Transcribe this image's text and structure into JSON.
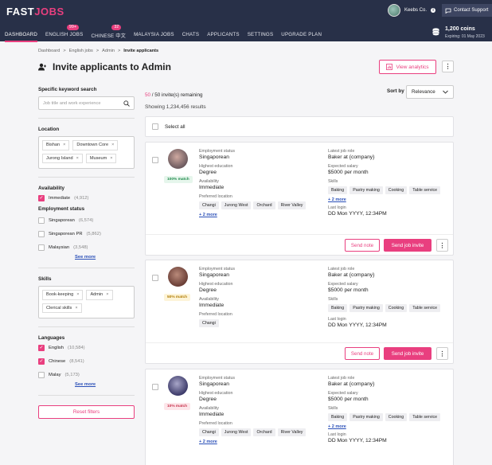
{
  "brand": {
    "logo_left": "FAST",
    "logo_right": "JOBS"
  },
  "colors": {
    "accent": "#e93f7f",
    "nav_bg": "#283048",
    "link": "#2b50b8"
  },
  "topbar": {
    "company": "Keebs Co.",
    "support": "Contact Support",
    "coins": "1,200 coins",
    "expiring": "Expiring: 01 May 2023"
  },
  "nav": [
    {
      "label": "DASHBOARD",
      "active": true,
      "badge": ""
    },
    {
      "label": "ENGLISH JOBS",
      "active": false,
      "badge": "99+"
    },
    {
      "label": "CHINESE 中文",
      "active": false,
      "badge": "32"
    },
    {
      "label": "MALAYSIA JOBS",
      "active": false,
      "badge": ""
    },
    {
      "label": "CHATS",
      "active": false,
      "badge": ""
    },
    {
      "label": "APPLICANTS",
      "active": false,
      "badge": ""
    },
    {
      "label": "SETTINGS",
      "active": false,
      "badge": ""
    },
    {
      "label": "UPGRADE PLAN",
      "active": false,
      "badge": ""
    }
  ],
  "breadcrumb": [
    "Dashboard",
    "English jobs",
    "Admin",
    "Invite applicants"
  ],
  "breadcrumb_sep": ">",
  "page_title": "Invite applicants to Admin",
  "view_analytics": "View analytics",
  "filters": {
    "keyword_label": "Specific keyword search",
    "keyword_placeholder": "Job title and work experience",
    "location_label": "Location",
    "locations": [
      "Bishan",
      "Downtown Core",
      "Jurong Island",
      "Museum"
    ],
    "availability_label": "Availability",
    "availability": [
      {
        "label": "Immediate",
        "count": "(4,912)",
        "checked": true
      }
    ],
    "employment_label": "Employment status",
    "employment": [
      {
        "label": "Singaporean",
        "count": "(6,574)",
        "checked": false
      },
      {
        "label": "Singaporean PR",
        "count": "(5,862)",
        "checked": false
      },
      {
        "label": "Malaysian",
        "count": "(3,548)",
        "checked": false
      }
    ],
    "see_more": "See more",
    "skills_label": "Skills",
    "skills": [
      "Book-keeping",
      "Admin",
      "Clerical skills"
    ],
    "languages_label": "Languages",
    "languages": [
      {
        "label": "English",
        "count": "(10,584)",
        "checked": true
      },
      {
        "label": "Chinese",
        "count": "(8,541)",
        "checked": true
      },
      {
        "label": "Malay",
        "count": "(5,173)",
        "checked": false
      }
    ],
    "reset": "Reset filters"
  },
  "results": {
    "remaining_num": "50",
    "remaining_rest": " / 50 invite(s) remaining",
    "showing": "Showing 1,234,456 results",
    "sort_label": "Sort by",
    "sort_value": "Relevance",
    "select_all": "Select all"
  },
  "labels": {
    "employment_status": "Employment status",
    "highest_education": "Highest education",
    "availability": "Availability",
    "preferred_location": "Preferred location",
    "latest_job_role": "Latest job role",
    "expected_salary": "Expected salary",
    "skills": "Skills",
    "last_login": "Last login",
    "send_note": "Send note",
    "send_invite": "Send job invite"
  },
  "applicants": [
    {
      "match": "100% match",
      "match_color": "#1f8a4c",
      "match_bg": "#e6f6ec",
      "employment_status": "Singaporean",
      "education": "Degree",
      "availability": "Immediate",
      "locations": [
        "Changi",
        "Jurong West",
        "Orchard",
        "River Valley"
      ],
      "locations_more": "+ 2 more",
      "job_role": "Baker at {company}",
      "salary": "$5000 per month",
      "skills": [
        "Baking",
        "Pastry making",
        "Cooking",
        "Table service"
      ],
      "skills_more": "+ 2 more",
      "last_login": "DD Mon YYYY, 12:34PM"
    },
    {
      "match": "50% match",
      "match_color": "#b07a00",
      "match_bg": "#fdf4d8",
      "employment_status": "Singaporean",
      "education": "Degree",
      "availability": "Immediate",
      "locations": [
        "Changi"
      ],
      "locations_more": "",
      "job_role": "Baker at {company}",
      "salary": "$5000 per month",
      "skills": [
        "Baking",
        "Pastry making",
        "Cooking",
        "Table service"
      ],
      "skills_more": "",
      "last_login": "DD Mon YYYY, 12:34PM"
    },
    {
      "match": "10% match",
      "match_color": "#c62f4a",
      "match_bg": "#fde6ea",
      "employment_status": "Singaporean",
      "education": "Degree",
      "availability": "Immediate",
      "locations": [
        "Changi",
        "Jurong West",
        "Orchard",
        "River Valley"
      ],
      "locations_more": "+ 2 more",
      "job_role": "Baker at {company}",
      "salary": "$5000 per month",
      "skills": [
        "Baking",
        "Pastry making",
        "Cooking",
        "Table service"
      ],
      "skills_more": "+ 2 more",
      "last_login": "DD Mon YYYY, 12:34PM"
    }
  ]
}
